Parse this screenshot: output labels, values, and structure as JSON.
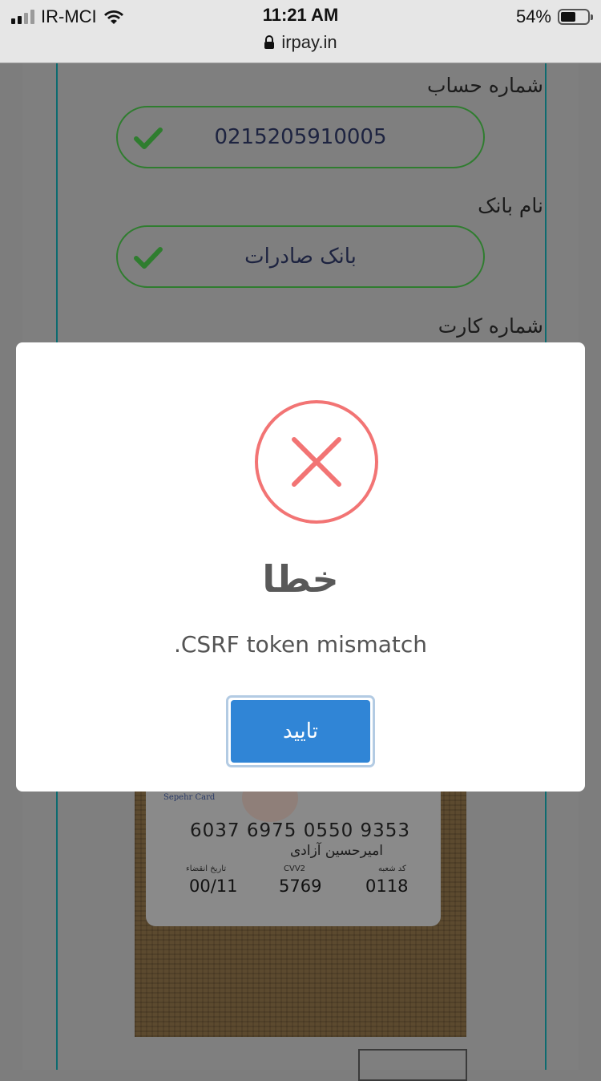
{
  "status_bar": {
    "carrier": "IR-MCI",
    "time": "11:21 AM",
    "battery": "54%",
    "url": "irpay.in"
  },
  "form": {
    "account_label": "شماره حساب",
    "account_value": "0215205910005",
    "bank_label": "نام بانک",
    "bank_value": "بانک صادرات",
    "card_label": "شماره کارت"
  },
  "card_photo": {
    "brand": "Sepehr Card",
    "number": "6037 6975 0550 9353",
    "holder": "امیرحسین آزادی",
    "expiry_label": "تاریخ انقضاء",
    "expiry": "00/11",
    "cvv_label": "CVV2",
    "cvv": "5769",
    "branch_label": "کد شعبه",
    "branch": "0118"
  },
  "modal": {
    "title": "خطا",
    "message": "CSRF token mismatch.",
    "confirm_label": "تایید"
  },
  "colors": {
    "error": "#f27474",
    "confirm": "#3085d6",
    "check": "#2f7d2f"
  }
}
